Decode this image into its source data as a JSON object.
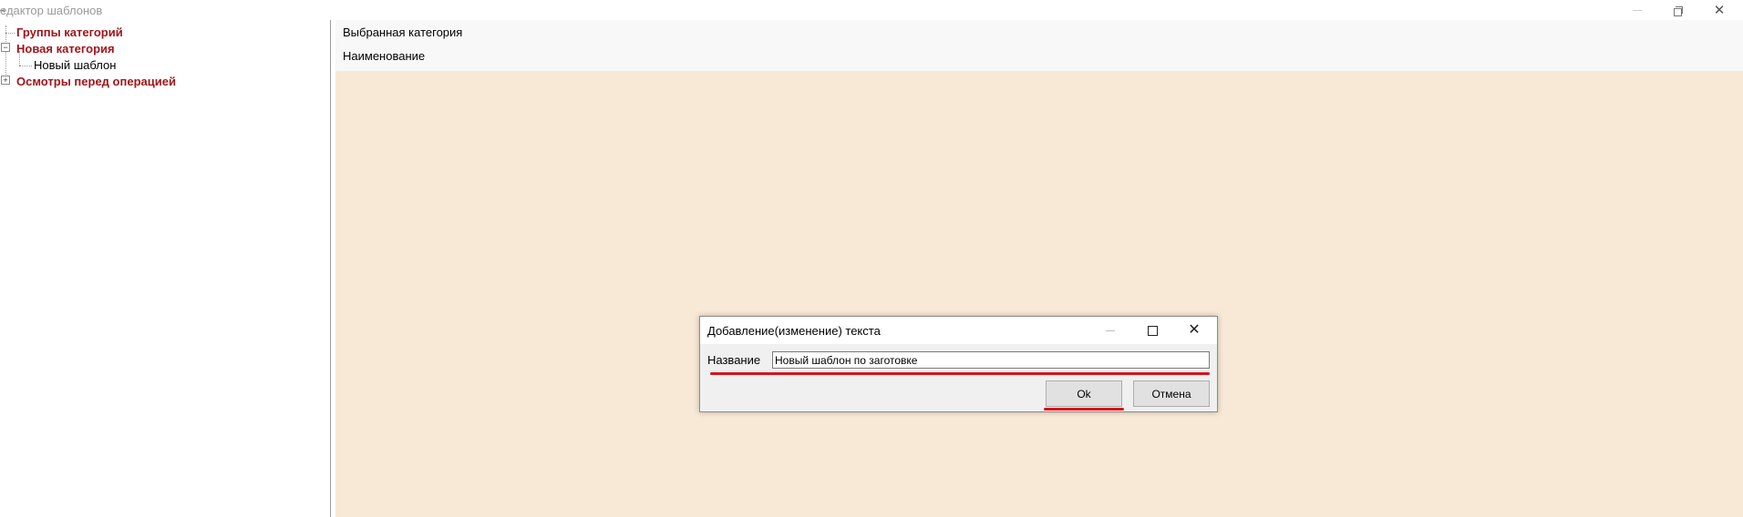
{
  "window": {
    "title": "едактор шаблонов"
  },
  "tree": {
    "items": [
      {
        "label": "Группы категорий",
        "bold": true
      },
      {
        "label": "Новая категория",
        "bold": true,
        "expander": "−"
      },
      {
        "label": "Новый шаблон",
        "bold": false
      },
      {
        "label": "Осмотры перед операцией",
        "bold": true,
        "expander": "+"
      }
    ]
  },
  "details": {
    "selected_category_label": "Выбранная категория",
    "name_label": "Наименование"
  },
  "dialog": {
    "title": "Добавление(изменение) текста",
    "field_label": "Название",
    "field_value": "Новый шаблон по заготовке",
    "ok_label": "Ok",
    "cancel_label": "Отмена",
    "close_glyph": "✕"
  },
  "colors": {
    "category_text": "#a0161b",
    "panel_background": "#f8e8d6",
    "highlight_underline": "#d6141b"
  },
  "icons": {
    "window_minimize": "minimize-icon",
    "window_restore": "restore-icon",
    "window_close": "close-icon",
    "dialog_minimize": "minimize-icon",
    "dialog_maximize": "maximize-icon",
    "dialog_close": "close-icon"
  }
}
